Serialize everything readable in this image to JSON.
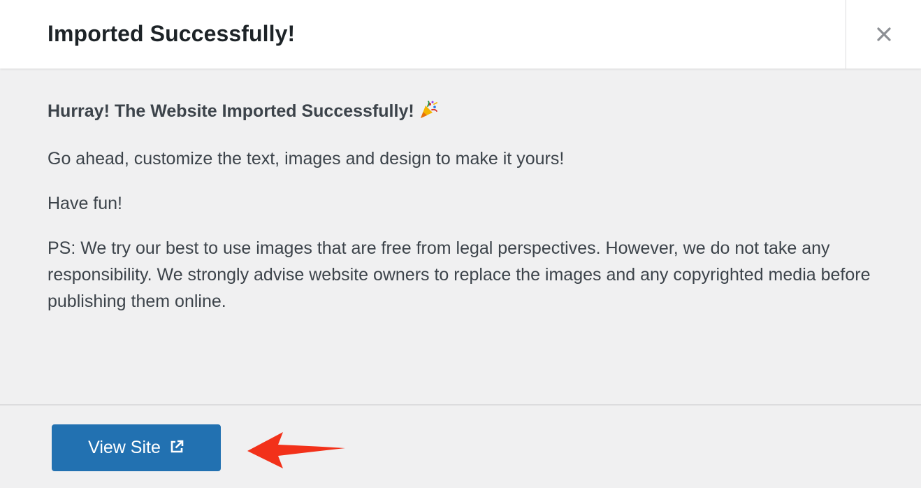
{
  "dialog": {
    "title": "Imported Successfully!",
    "close_icon": "close-icon"
  },
  "body": {
    "lead": "Hurray! The Website Imported Successfully!",
    "lead_icon": "party-popper-icon",
    "paragraphs": [
      "Go ahead, customize the text, images and design to make it yours!",
      "Have fun!",
      "PS: We try our best to use images that are free from legal perspectives. However, we do not take any responsibility. We strongly advise website owners to replace the images and any copyrighted media before publishing them online."
    ]
  },
  "footer": {
    "view_site_label": "View Site",
    "view_site_icon": "external-link-icon"
  },
  "annotation": {
    "arrow_icon": "red-arrow-icon"
  },
  "colors": {
    "primary_button": "#2271b1",
    "annotation_arrow": "#f2311a",
    "body_background": "#f0f0f1",
    "header_background": "#ffffff"
  }
}
